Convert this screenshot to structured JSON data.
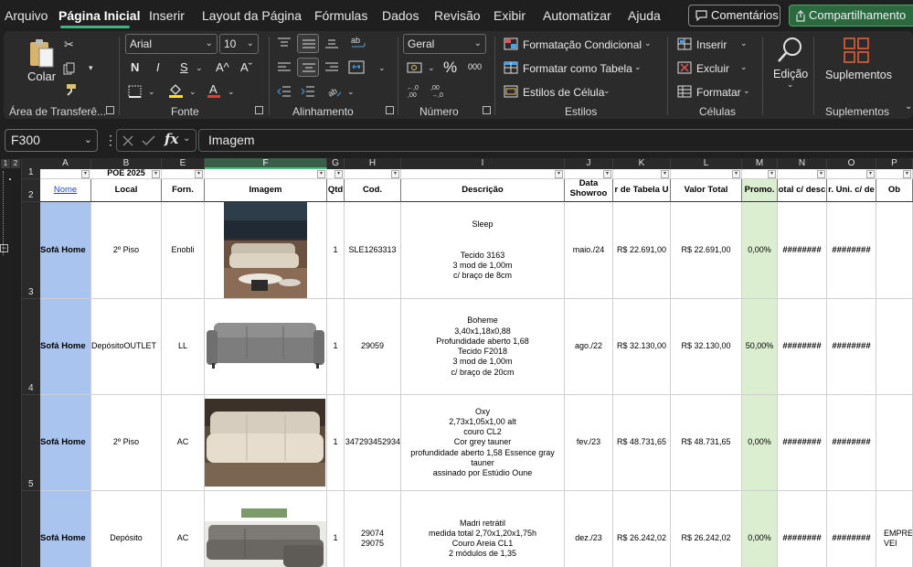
{
  "menu": {
    "tabs": [
      "Arquivo",
      "Página Inicial",
      "Inserir",
      "Layout da Página",
      "Fórmulas",
      "Dados",
      "Revisão",
      "Exibir",
      "Automatizar",
      "Ajuda"
    ],
    "comments_label": "Comentários",
    "share_label": "Compartilhamento"
  },
  "ribbon": {
    "clipboard": {
      "paste_label": "Colar",
      "group_label": "Área de Transferê..."
    },
    "font": {
      "family": "Arial",
      "size": "10",
      "bold": "N",
      "italic": "I",
      "underline": "S",
      "grow": "A^",
      "shrink": "Aˇ",
      "group_label": "Fonte"
    },
    "alignment": {
      "group_label": "Alinhamento"
    },
    "number": {
      "format": "Geral",
      "group_label": "Número"
    },
    "styles": {
      "conditional": "Formatação Condicional",
      "as_table": "Formatar como Tabela",
      "cell_styles": "Estilos de Célula",
      "group_label": "Estilos"
    },
    "cells": {
      "insert": "Inserir",
      "delete": "Excluir",
      "format": "Formatar",
      "group_label": "Células"
    },
    "editing": {
      "label": "Edição"
    },
    "addins": {
      "label": "Suplementos",
      "group_label": "Suplementos"
    }
  },
  "formula_bar": {
    "name_box": "F300",
    "content": "Imagem"
  },
  "outline_levels": [
    "1",
    "2"
  ],
  "columns": [
    "A",
    "B",
    "E",
    "F",
    "G",
    "H",
    "I",
    "J",
    "K",
    "L",
    "M",
    "N",
    "O",
    "P"
  ],
  "row_numbers": [
    "1",
    "2",
    "3",
    "4",
    "5"
  ],
  "row1": {
    "poe": "POE 2025"
  },
  "headers": {
    "nome": "Nome",
    "local": "Local",
    "forn": "Forn.",
    "imagem": "Imagem",
    "qtd": "Qtd",
    "cod": "Cod.",
    "descricao": "Descrição",
    "data": "Data\nShowroo\nm",
    "valor_tabela": "r de Tabela U",
    "valor_total": "Valor Total",
    "promo": "Promo.",
    "total_desc": "otal c/ desc",
    "unit_desc": "r. Uni. c/ de",
    "obs": "Ob"
  },
  "rows": [
    {
      "nome": "Sofá Home",
      "local": "2º Piso",
      "forn": "Enobli",
      "qtd": "1",
      "cod": "SLE1263313",
      "descricao": "Sleep\n\n\nTecido 3163\n3 mod de 1,00m\nc/ braço de 8cm",
      "data": "maio./24",
      "valor_tabela": "R$ 22.691,00",
      "valor_total": "R$ 22.691,00",
      "promo": "0,00%",
      "total_desc": "########",
      "unit_desc": "########",
      "obs": ""
    },
    {
      "nome": "Sofá Home",
      "local": "DepósitoOUTLET",
      "forn": "LL",
      "qtd": "1",
      "cod": "29059",
      "descricao": "Boheme\n3,40x1,18x0,88\nProfundidade aberto 1,68\nTecido F2018\n3 mod de 1,00m\nc/ braço de 20cm",
      "data": "ago./22",
      "valor_tabela": "R$ 32.130,00",
      "valor_total": "R$ 32.130,00",
      "promo": "50,00%",
      "total_desc": "########",
      "unit_desc": "########",
      "obs": ""
    },
    {
      "nome": "Sofá Home",
      "local": "2º Piso",
      "forn": "AC",
      "qtd": "1",
      "cod": "347293452934",
      "descricao": "Oxy\n2,73x1,05x1,00 alt\ncouro  CL2\nCor grey tauner\nprofundidade aberto 1,58 Essence gray\ntauner\nassinado por Estúdio Oune",
      "data": "fev./23",
      "valor_tabela": "R$ 48.731,65",
      "valor_total": "R$ 48.731,65",
      "promo": "0,00%",
      "total_desc": "########",
      "unit_desc": "########",
      "obs": ""
    },
    {
      "nome": "Sofá Home",
      "local": "Depósito",
      "forn": "AC",
      "qtd": "1",
      "cod": "29074\n29075",
      "descricao": "Madri retrátil\nmedida total 2,70x1,20x1,75h\nCouro Areia CL1\n2 módulos de 1,35",
      "data": "dez./23",
      "valor_tabela": "R$ 26.242,02",
      "valor_total": "R$ 26.242,02",
      "promo": "0,00%",
      "total_desc": "########",
      "unit_desc": "########",
      "obs": "EMPRE\nVEI"
    }
  ],
  "colors": {
    "accent_green": "#3fb37f",
    "name_col_blue": "#a9c4ee",
    "promo_green": "#dbeecf",
    "share_bg": "#2b6a3f"
  }
}
